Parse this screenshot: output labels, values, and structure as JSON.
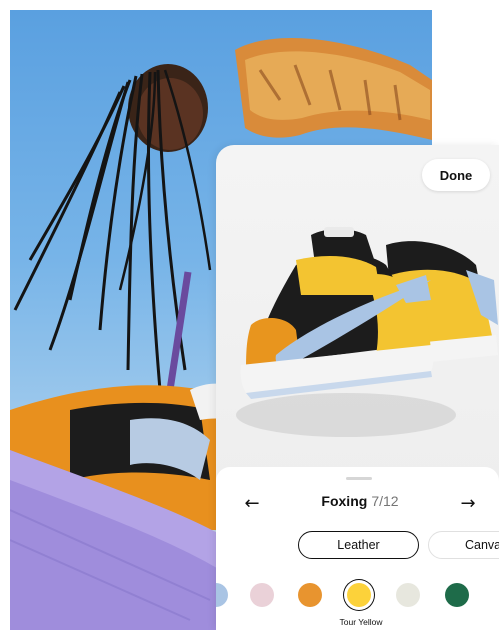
{
  "app": {
    "done_label": "Done"
  },
  "customizer": {
    "step_name": "Foxing",
    "step_count": "7/12",
    "prev_icon": "arrow-left-icon",
    "next_icon": "arrow-right-icon",
    "prev_glyph": "←",
    "next_glyph": "→",
    "materials": [
      {
        "label": "Leather",
        "selected": true
      },
      {
        "label": "Canvas",
        "selected": false
      }
    ],
    "colors": [
      {
        "hex": "#a9c4e4",
        "selected": false
      },
      {
        "hex": "#ead1d8",
        "selected": false
      },
      {
        "hex": "#e8942f",
        "selected": false
      },
      {
        "hex": "#fcd23a",
        "selected": true
      },
      {
        "hex": "#e7e7de",
        "selected": false
      },
      {
        "hex": "#1e6b49",
        "selected": false
      }
    ],
    "selected_color_name": "Tour Yellow"
  },
  "theme": {
    "shoe_yellow": "#f3c431",
    "shoe_black": "#1c1c1c",
    "shoe_orange": "#e8951e",
    "swoosh_blue": "#a9c4e4",
    "sole_white": "#f4f4f4"
  }
}
